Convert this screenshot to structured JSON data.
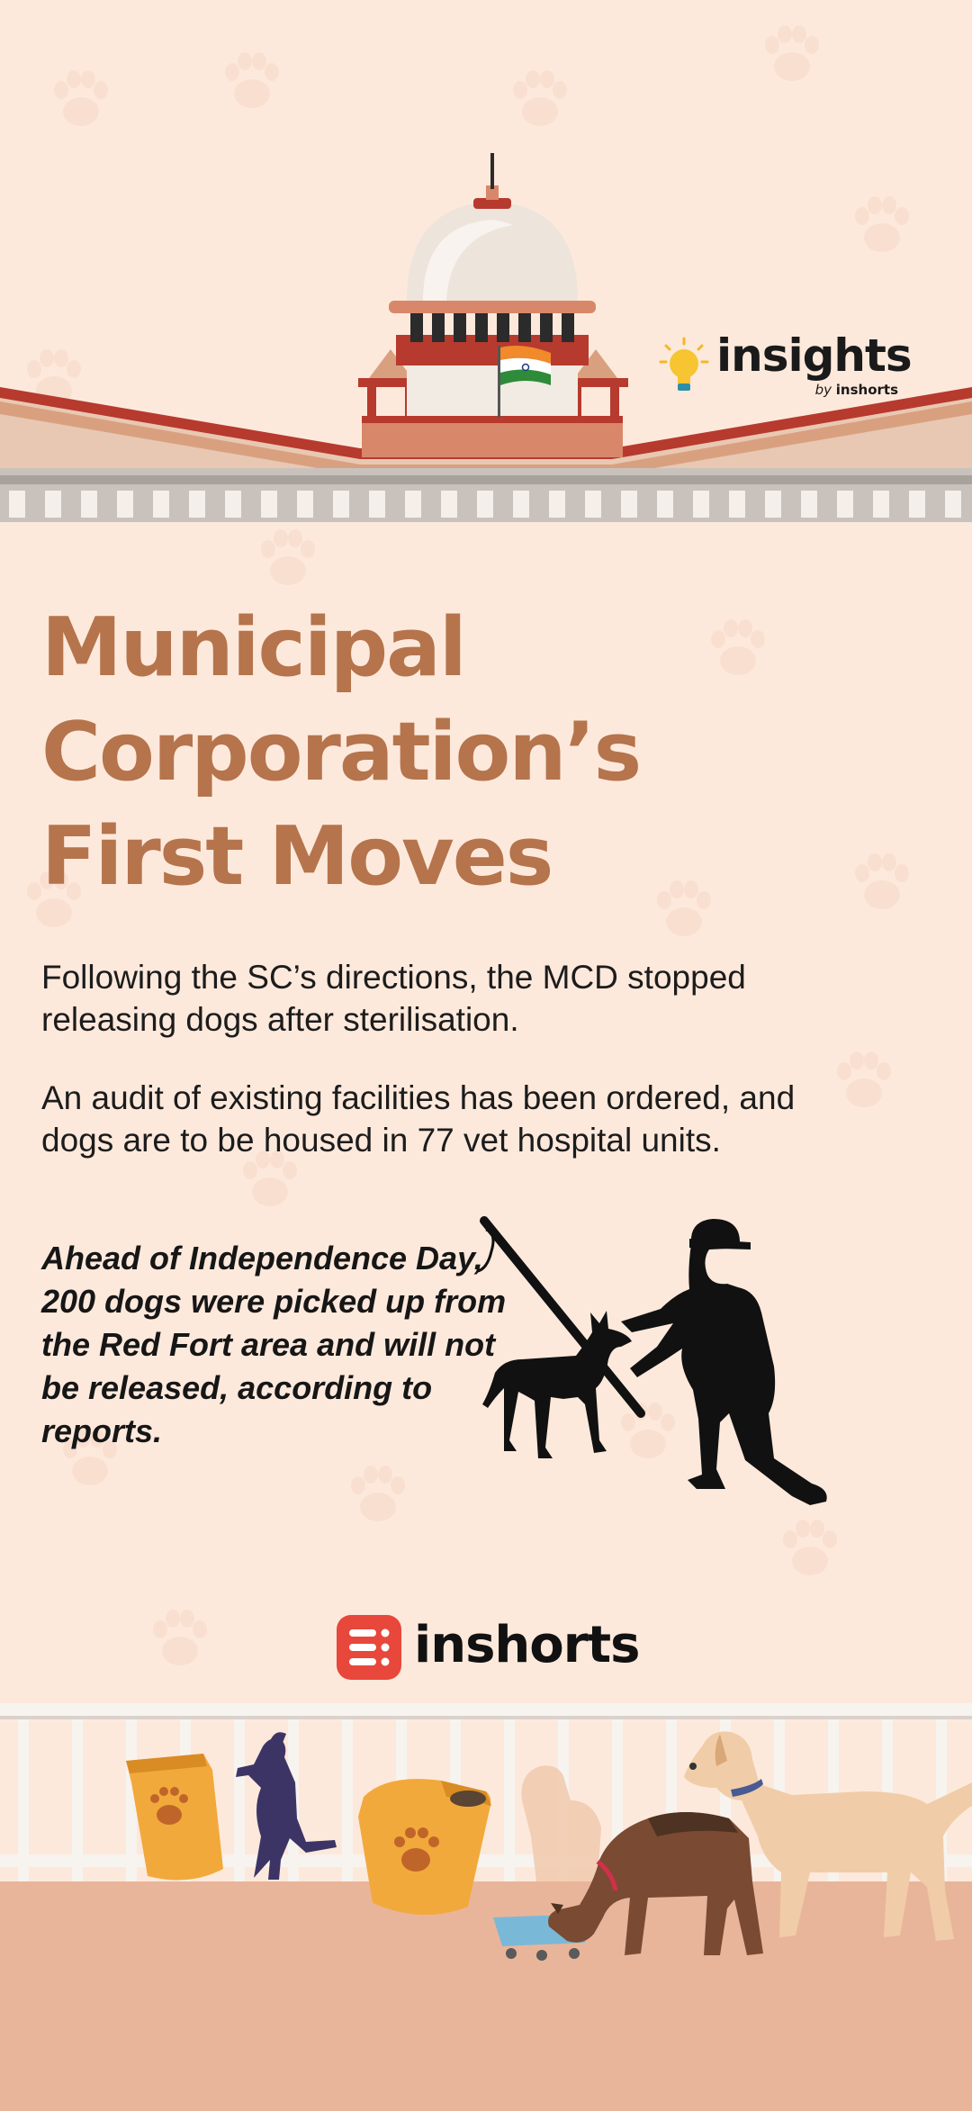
{
  "brand": {
    "insights_word": "insights",
    "insights_by": "by",
    "insights_by_brand": "inshorts",
    "footer_word": "inshorts"
  },
  "title": {
    "lines": [
      "Municipal",
      "Corporation’s",
      "First Moves"
    ]
  },
  "body": {
    "paragraph_1": "Following the SC’s directions, the MCD stopped releasing dogs after sterilisation.",
    "paragraph_2": "An audit of existing facilities has been ordered, and dogs are to be housed in 77 vet hospital units.",
    "highlight": "Ahead of Independence Day, 200 dogs were picked up from the Red Fort area and will not be released, according to reports."
  },
  "colors": {
    "background": "#fde9dc",
    "title": "#b5744c",
    "court_red": "#b73a2e",
    "brand_red": "#e8473b",
    "flag_saffron": "#f08a2a",
    "flag_green": "#2e8b3a"
  },
  "icons": [
    "supreme-court-building-illustration",
    "indian-flag-icon",
    "lightbulb-icon",
    "dog-catcher-silhouette",
    "dog-silhouette",
    "inshorts-logo-icon",
    "dog-food-bag-icon",
    "paw-print-icon",
    "food-bowl-icon"
  ]
}
